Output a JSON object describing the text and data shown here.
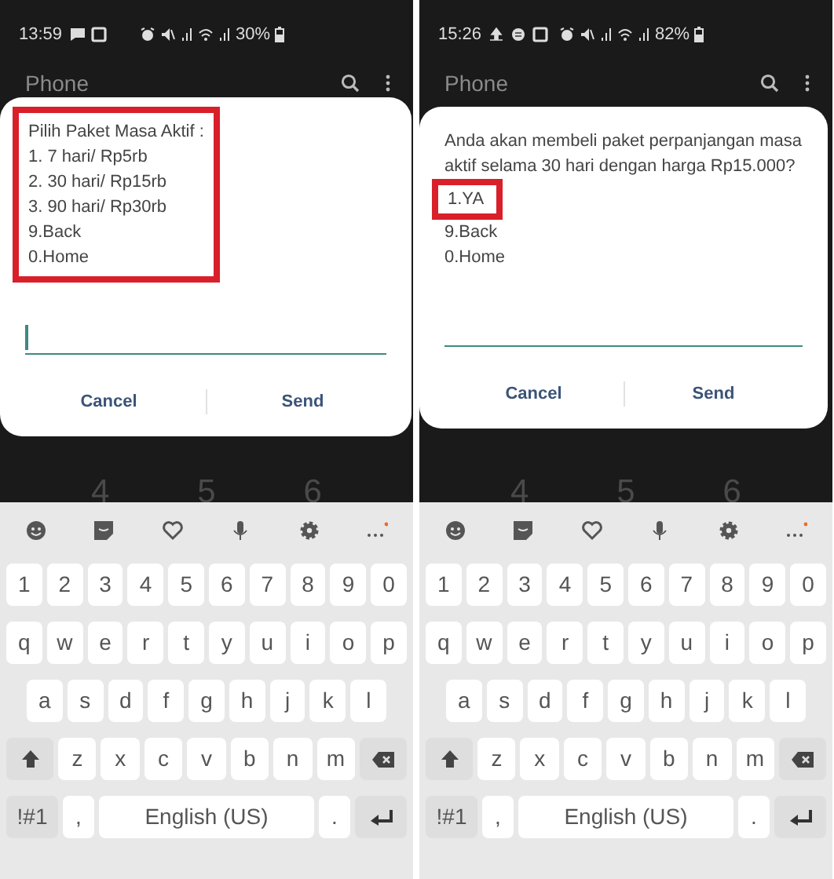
{
  "panels": [
    {
      "status_bar": {
        "time": "13:59",
        "notifications": [
          {
            "kind": "message"
          },
          {
            "kind": "gallery"
          }
        ],
        "battery": "30%"
      },
      "app_bar": {
        "title": "Phone"
      },
      "dialog": {
        "lines": [
          {
            "text": "Pilih Paket Masa Aktif :",
            "highlighted": true
          },
          {
            "text": "1. 7 hari/ Rp5rb",
            "highlighted": true
          },
          {
            "text": "2. 30 hari/ Rp15rb",
            "highlighted": true
          },
          {
            "text": "3. 90 hari/ Rp30rb",
            "highlighted": true
          },
          {
            "text": "9.Back",
            "highlighted": true
          },
          {
            "text": "0.Home",
            "highlighted": true
          }
        ],
        "cursor": true,
        "buttons": [
          "Cancel",
          "Send"
        ]
      },
      "keypad_peek": [
        "4",
        "5",
        "6"
      ],
      "keyboard": {
        "rows": [
          [
            "1",
            "2",
            "3",
            "4",
            "5",
            "6",
            "7",
            "8",
            "9",
            "0"
          ],
          [
            "q",
            "w",
            "e",
            "r",
            "t",
            "y",
            "u",
            "i",
            "o",
            "p"
          ],
          [
            "a",
            "s",
            "d",
            "f",
            "g",
            "h",
            "j",
            "k",
            "l"
          ],
          [
            "z",
            "x",
            "c",
            "v",
            "b",
            "n",
            "m"
          ]
        ],
        "symbols_key": "!#1",
        "comma_key": ",",
        "space_key": "English (US)",
        "period_key": "."
      }
    },
    {
      "status_bar": {
        "time": "15:26",
        "notifications": [
          {
            "kind": "upload"
          },
          {
            "kind": "circle"
          },
          {
            "kind": "gallery"
          }
        ],
        "battery": "82%"
      },
      "app_bar": {
        "title": "Phone"
      },
      "dialog": {
        "lines": [
          {
            "text": "Anda akan membeli paket perpanjangan masa aktif selama 30 hari dengan harga Rp15.000?",
            "highlighted": false
          },
          {
            "text": "1.YA",
            "highlighted": true
          },
          {
            "text": "9.Back",
            "highlighted": false
          },
          {
            "text": "0.Home",
            "highlighted": false
          }
        ],
        "buttons": [
          "Cancel",
          "Send"
        ]
      },
      "keypad_peek": [
        "4",
        "5",
        "6"
      ],
      "keyboard": {
        "rows": [
          [
            "1",
            "2",
            "3",
            "4",
            "5",
            "6",
            "7",
            "8",
            "9",
            "0"
          ],
          [
            "q",
            "w",
            "e",
            "r",
            "t",
            "y",
            "u",
            "i",
            "o",
            "p"
          ],
          [
            "a",
            "s",
            "d",
            "f",
            "g",
            "h",
            "j",
            "k",
            "l"
          ],
          [
            "z",
            "x",
            "c",
            "v",
            "b",
            "n",
            "m"
          ]
        ],
        "symbols_key": "!#1",
        "comma_key": ",",
        "space_key": "English (US)",
        "period_key": "."
      }
    }
  ]
}
